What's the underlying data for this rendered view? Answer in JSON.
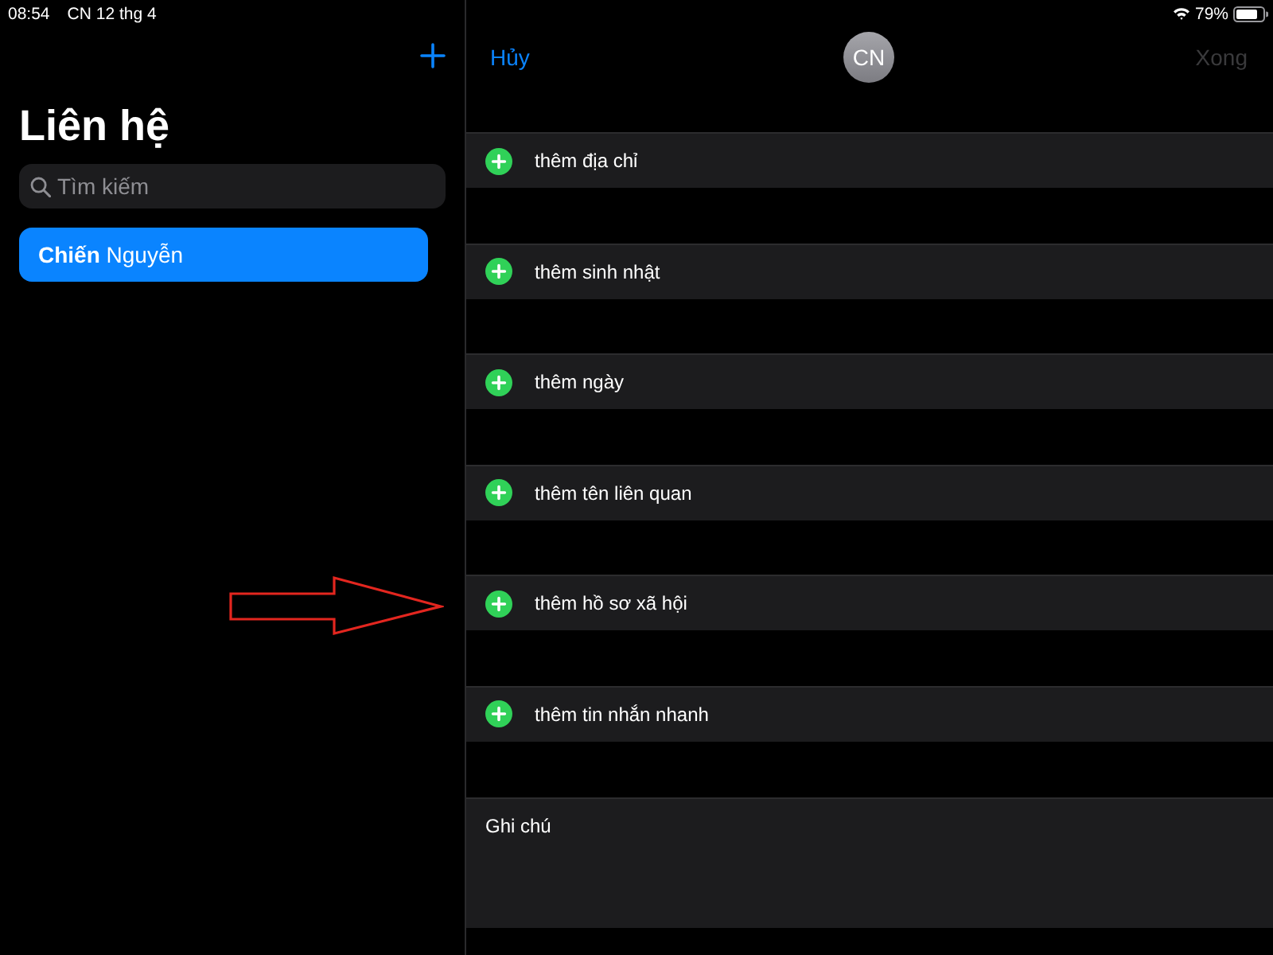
{
  "status_bar": {
    "time": "08:54",
    "date": "CN 12 thg 4",
    "battery": "79%"
  },
  "contacts_pane": {
    "title": "Liên hệ",
    "search": {
      "placeholder": "Tìm kiếm"
    },
    "contacts": [
      {
        "name": "**Chiến** Nguyễn",
        "selected": true
      }
    ]
  },
  "edit_pane": {
    "cancel": "Hủy",
    "avatar_initials": "CN",
    "done": {
      "label": "Xong",
      "disabled": true
    },
    "add_fields": [
      {
        "label": "thêm địa chỉ"
      },
      {
        "label": "thêm sinh nhật"
      },
      {
        "label": "thêm ngày"
      },
      {
        "label": "thêm tên liên quan"
      },
      {
        "label": "thêm hồ sơ xã hội"
      },
      {
        "label": "thêm tin nhắn nhanh"
      }
    ],
    "notes": {
      "label": "Ghi chú"
    }
  }
}
